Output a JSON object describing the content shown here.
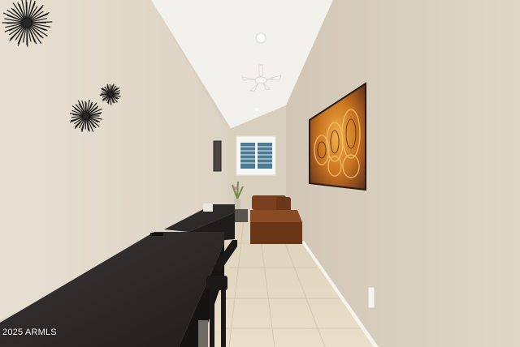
{
  "watermark": "2025 ARMLS",
  "colors": {
    "left_wall": "#e4dccd",
    "right_wall": "#ddd3c3",
    "back_wall": "#d9cfbf",
    "ceiling": "#f3f1ec",
    "floor": "#e1d6bf",
    "desk": "#2c2928",
    "bench": "#7a3f1f",
    "artwork_gold": "#d58b2e",
    "artwork_dark": "#5a2c1d",
    "baseboard": "#f6f3ee"
  },
  "icons": [
    "sea-urchin-wall-art-icon",
    "ceiling-fan-icon",
    "recessed-light-icon",
    "outlet-icon"
  ]
}
